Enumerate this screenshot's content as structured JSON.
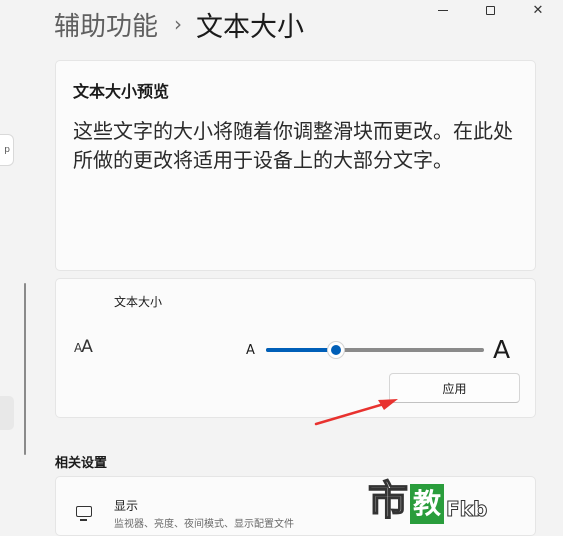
{
  "sidebar": {
    "pill_glyph": "p"
  },
  "header": {
    "parent": "辅助功能",
    "separator": "›",
    "current": "文本大小"
  },
  "window": {
    "minimize": "—",
    "maximize": "☐",
    "close": "✕"
  },
  "preview": {
    "title": "文本大小预览",
    "text": "这些文字的大小将随着你调整滑块而更改。在此处所做的更改将适用于设备上的大部分文字。"
  },
  "text_size": {
    "label": "文本大小",
    "icon": "text-size-icon",
    "icon_glyph_large": "A",
    "icon_glyph_small": "A",
    "slider_min_label": "A",
    "slider_max_label": "A",
    "slider_value_fraction": 0.32,
    "apply_label": "应用"
  },
  "related": {
    "heading": "相关设置",
    "items": [
      {
        "title": "显示",
        "subtitle": "监视器、亮度、夜间模式、显示配置文件",
        "icon": "monitor-icon"
      }
    ]
  },
  "annotation": {
    "arrow_color": "#e8322f"
  },
  "watermark": {
    "part1": "市",
    "part2": "教",
    "part3": "Fkb"
  },
  "colors": {
    "accent": "#005fb8",
    "background": "#f3f3f3",
    "card": "#fbfbfb"
  }
}
